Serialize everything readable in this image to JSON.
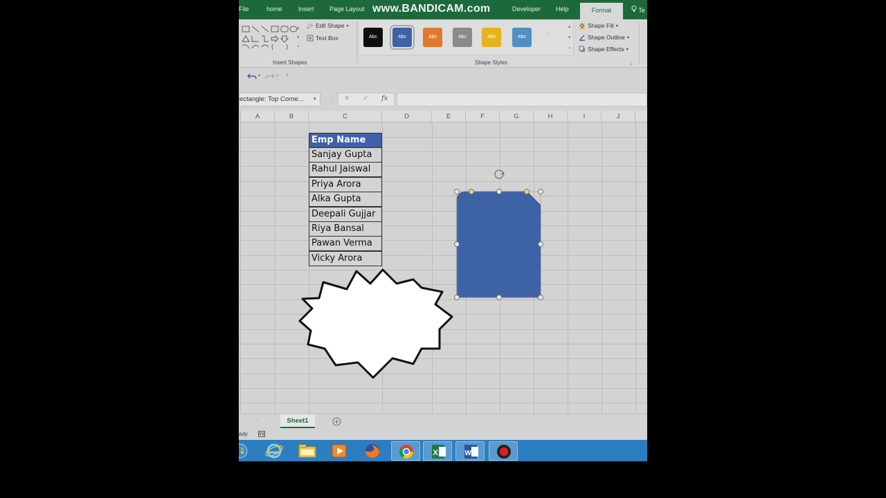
{
  "ribbon_tabs": [
    "File",
    "home",
    "Insert",
    "Page Layout",
    "Developer",
    "Help",
    "Format",
    "Te"
  ],
  "watermark": "www.BANDICAM.com",
  "ribbon": {
    "edit_shape": "Edit Shape",
    "text_box": "Text Box",
    "insert_shapes_label": "Insert Shapes",
    "shape_styles_label": "Shape Styles",
    "swatch_text": "Abc",
    "swatch_colors": [
      "#0e0e0e",
      "#3d62a5",
      "#e07a2a",
      "#8a8a8a",
      "#e5b41a",
      "#4f8fc5"
    ],
    "shape_fill": "Shape Fill",
    "shape_outline": "Shape Outline",
    "shape_effects": "Shape Effects"
  },
  "formula_bar": {
    "name_box": "ectangle: Top Corne...",
    "fx": "fx"
  },
  "columns": [
    "A",
    "B",
    "C",
    "D",
    "E",
    "F",
    "G",
    "H",
    "I",
    "J"
  ],
  "table": {
    "header": "Emp Name",
    "rows": [
      "Sanjay Gupta",
      "Rahul Jaiswal",
      "Priya Arora",
      "Alka Gupta",
      "Deepali Gujjar",
      "Riya Bansal",
      "Pawan Verma",
      "Vicky Arora"
    ]
  },
  "sheet_tab": "Sheet1",
  "status_text": "ady",
  "colors": {
    "excel_green": "#1c6a3c",
    "header_blue": "#3e62a8",
    "shape_blue": "#3d62a5",
    "taskbar_blue": "#2d7ec0"
  },
  "taskbar_icons": [
    "start-orb-icon",
    "ie-icon",
    "explorer-icon",
    "media-player-icon",
    "firefox-icon",
    "chrome-icon",
    "excel-icon",
    "word-icon",
    "bandicam-record-icon"
  ]
}
